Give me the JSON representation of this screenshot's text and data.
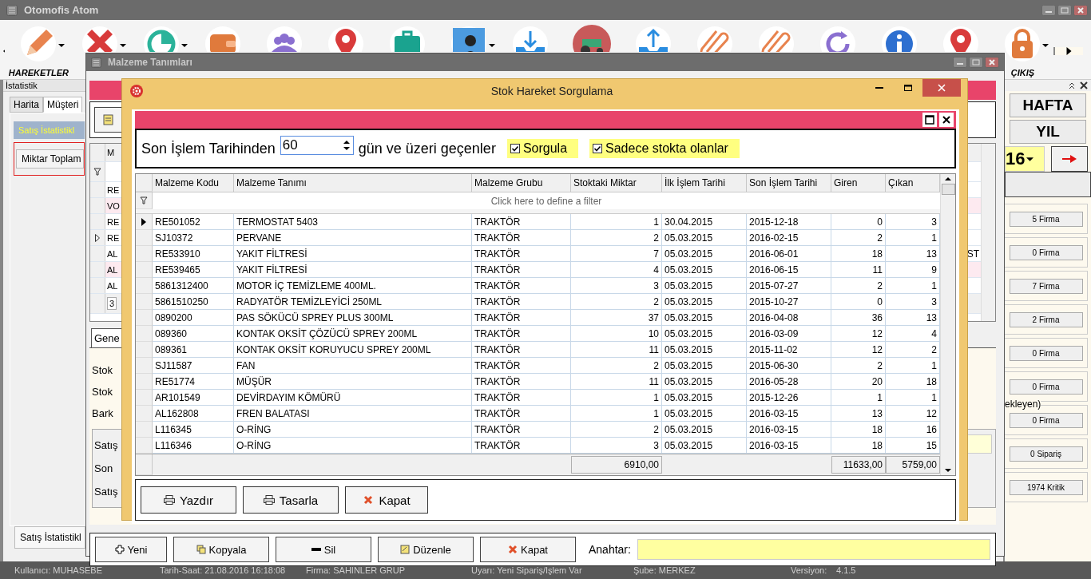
{
  "app": {
    "title": "Otomofis Atom"
  },
  "toolbar": [
    {
      "kind": "pencil",
      "label": "HAREKETLER",
      "dropdown": true
    },
    {
      "kind": "tools",
      "dropdown": true
    },
    {
      "kind": "chart",
      "dropdown": true
    },
    {
      "kind": "wallet",
      "dropdown": false
    },
    {
      "kind": "group",
      "dropdown": false
    },
    {
      "kind": "pin",
      "dropdown": false
    },
    {
      "kind": "briefcase",
      "dropdown": false
    },
    {
      "kind": "person",
      "dropdown": true
    },
    {
      "kind": "download",
      "dropdown": false
    },
    {
      "kind": "tractor",
      "dropdown": false
    },
    {
      "kind": "upload",
      "dropdown": false
    },
    {
      "kind": "clip",
      "dropdown": false
    },
    {
      "kind": "clip",
      "dropdown": false
    },
    {
      "kind": "refresh",
      "dropdown": false
    },
    {
      "kind": "info",
      "dropdown": false
    },
    {
      "kind": "pin",
      "dropdown": false
    },
    {
      "kind": "lock",
      "label": "ÇIKIŞ",
      "dropdown": true
    }
  ],
  "left_panel": {
    "title": "İstatistik",
    "tabs": [
      {
        "label": "Harita",
        "selected": false
      },
      {
        "label": "Müşteri",
        "selected": true
      }
    ],
    "header": "Satış İstatistikl",
    "field": "Miktar Toplam",
    "bottom_tab": "Satış İstatistikl"
  },
  "right_panel": {
    "buttons": [
      "HAFTA",
      "YIL"
    ],
    "year": "16",
    "counters": [
      {
        "value": "5 Firma"
      },
      {
        "value": "0 Firma"
      },
      {
        "value": "7 Firma"
      },
      {
        "value": "2 Firma"
      },
      {
        "value": "0 Firma"
      },
      {
        "value": "0 Firma"
      },
      {
        "caption": "ekleyen)",
        "value": "0 Firma"
      },
      {
        "value": "0 Sipariş"
      },
      {
        "value": "1974 Kritik"
      }
    ]
  },
  "material_window": {
    "title": "Malzeme Tanımları",
    "grid_header": "M",
    "grid_rows": [
      {
        "code": "RE",
        "current": false,
        "highlighted": false
      },
      {
        "code": "VO",
        "current": false,
        "highlighted": true
      },
      {
        "code": "RE",
        "current": false,
        "highlighted": false
      },
      {
        "code": "RE",
        "current": true,
        "highlighted": false
      },
      {
        "code": "AL",
        "current": false,
        "highlighted": false,
        "tail": "ST"
      },
      {
        "code": "AL",
        "current": false,
        "highlighted": true
      },
      {
        "code": "AL",
        "current": false,
        "highlighted": false
      }
    ],
    "grid_footer": "3",
    "tab": "Gene",
    "labels": [
      "Stok",
      "Stok",
      "Bark"
    ],
    "group_labels": [
      "Satış",
      "Son",
      "Satış"
    ],
    "buttons": [
      {
        "kind": "add",
        "label": "Yeni"
      },
      {
        "kind": "copy",
        "label": "Kopyala"
      },
      {
        "kind": "remove",
        "label": "Sil"
      },
      {
        "kind": "edit",
        "label": "Düzenle"
      },
      {
        "kind": "close",
        "label": "Kapat"
      }
    ],
    "search_label": "Anahtar:"
  },
  "dialog": {
    "title": "Stok Hareket Sorgulama",
    "prefix": "Son İşlem Tarihinden",
    "days": "60",
    "suffix": "gün ve üzeri geçenler",
    "options": [
      {
        "label": "Sorgula",
        "checked": true
      },
      {
        "label": "Sadece stokta olanlar",
        "checked": true
      }
    ],
    "columns": [
      "Malzeme Kodu",
      "Malzeme Tanımı",
      "Malzeme Grubu",
      "Stoktaki Miktar",
      "İlk İşlem Tarihi",
      "Son İşlem Tarihi",
      "Giren",
      "Çıkan"
    ],
    "filter_hint": "Click here to define a filter",
    "rows": [
      {
        "selected": true,
        "cells": [
          "RE501052",
          "TERMOSTAT 5403",
          "TRAKTÖR",
          "1",
          "30.04.2015",
          "2015-12-18",
          "0",
          "3"
        ]
      },
      {
        "selected": false,
        "cells": [
          "SJ10372",
          "PERVANE",
          "TRAKTÖR",
          "2",
          "05.03.2015",
          "2016-02-15",
          "2",
          "1"
        ]
      },
      {
        "selected": false,
        "cells": [
          "RE533910",
          "YAKIT FİLTRESİ",
          "TRAKTÖR",
          "7",
          "05.03.2015",
          "2016-06-01",
          "18",
          "13"
        ]
      },
      {
        "selected": false,
        "cells": [
          "RE539465",
          "YAKIT FİLTRESİ",
          "TRAKTÖR",
          "4",
          "05.03.2015",
          "2016-06-15",
          "11",
          "9"
        ]
      },
      {
        "selected": false,
        "cells": [
          "5861312400",
          "MOTOR İÇ TEMİZLEME 400ML.",
          "TRAKTÖR",
          "3",
          "05.03.2015",
          "2015-07-27",
          "2",
          "1"
        ]
      },
      {
        "selected": false,
        "cells": [
          "5861510250",
          "RADYATÖR TEMİZLEYİCİ 250ML",
          "TRAKTÖR",
          "2",
          "05.03.2015",
          "2015-10-27",
          "0",
          "3"
        ]
      },
      {
        "selected": false,
        "cells": [
          "0890200",
          "PAS SÖKÜCÜ SPREY PLUS 300ML",
          "TRAKTÖR",
          "37",
          "05.03.2015",
          "2016-04-08",
          "36",
          "13"
        ]
      },
      {
        "selected": false,
        "cells": [
          "089360",
          "KONTAK OKSİT ÇÖZÜCÜ SPREY 200ML",
          "TRAKTÖR",
          "10",
          "05.03.2015",
          "2016-03-09",
          "12",
          "4"
        ]
      },
      {
        "selected": false,
        "cells": [
          "089361",
          "KONTAK OKSİT KORUYUCU SPREY 200ML",
          "TRAKTÖR",
          "11",
          "05.03.2015",
          "2015-11-02",
          "12",
          "2"
        ]
      },
      {
        "selected": false,
        "cells": [
          "SJ11587",
          "FAN",
          "TRAKTÖR",
          "2",
          "05.03.2015",
          "2015-06-30",
          "2",
          "1"
        ]
      },
      {
        "selected": false,
        "cells": [
          "RE51774",
          "MÜŞÜR",
          "TRAKTÖR",
          "11",
          "05.03.2015",
          "2016-05-28",
          "20",
          "18"
        ]
      },
      {
        "selected": false,
        "cells": [
          "AR101549",
          "DEVİRDAYIM KÖMÜRÜ",
          "TRAKTÖR",
          "1",
          "05.03.2015",
          "2015-12-26",
          "1",
          "1"
        ]
      },
      {
        "selected": false,
        "cells": [
          "AL162808",
          "FREN BALATASI",
          "TRAKTÖR",
          "1",
          "05.03.2015",
          "2016-03-15",
          "13",
          "12"
        ]
      },
      {
        "selected": false,
        "cells": [
          "L116345",
          "O-RİNG",
          "TRAKTÖR",
          "2",
          "05.03.2015",
          "2016-03-15",
          "18",
          "16"
        ]
      },
      {
        "selected": false,
        "cells": [
          "L116346",
          "O-RİNG",
          "TRAKTÖR",
          "3",
          "05.03.2015",
          "2016-03-15",
          "18",
          "15"
        ]
      }
    ],
    "totals": {
      "stock": "6910,00",
      "in": "11633,00",
      "out": "5759,00"
    },
    "buttons": [
      {
        "kind": "print",
        "label": "Yazdır"
      },
      {
        "kind": "print",
        "label": "Tasarla"
      },
      {
        "kind": "close",
        "label": "Kapat"
      }
    ]
  },
  "status_bar": [
    "Kullanıcı: MUHASEBE",
    "Tarih-Saat: 21.08.2016 16:18:08",
    "Firma: SAHINLER GRUP",
    "Uyarı: Yeni Sipariş/İşlem Var",
    "Şube: MERKEZ",
    "Versiyon:",
    "4.1.5"
  ]
}
